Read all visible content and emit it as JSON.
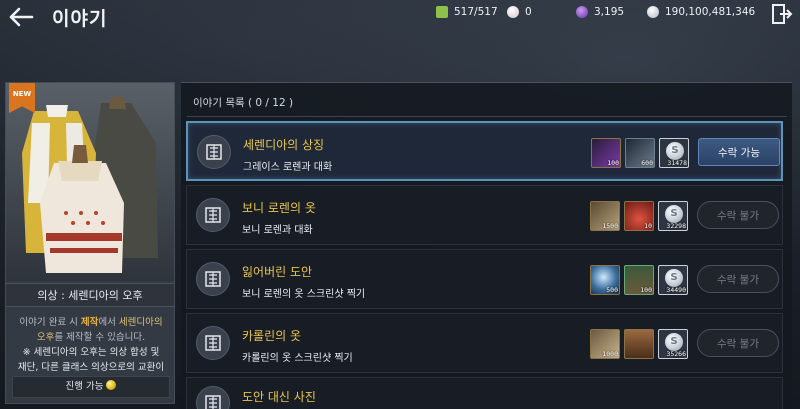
{
  "header": {
    "title": "이야기",
    "resources": [
      {
        "name": "contribution-points",
        "value": "517/517",
        "color": "#8fbf4c"
      },
      {
        "name": "pearls",
        "value": "0",
        "color": "#e9d7db"
      },
      {
        "name": "energy",
        "value": "3,195",
        "color": "#8a53c8"
      },
      {
        "name": "silver",
        "value": "190,100,481,346",
        "color": "#c9d3de"
      }
    ]
  },
  "card": {
    "badge": "NEW",
    "name": "의상 : 세렌디아의 오후",
    "desc": {
      "p1": "이야기 완료 시 ",
      "p2": "제작",
      "p3": "에서 ",
      "p4": "세렌디아의",
      "p5": "오후",
      "p6": "를 제작할 수 있습니다.",
      "p7": "※ 세렌디아의 오후는 의상 합성 및",
      "p8": "재단, 다른 클래스 의상으로의 교환이"
    },
    "progress_label": "진행 가능"
  },
  "list": {
    "title": "이야기 목록 ( 0 / 12 )",
    "quests": [
      {
        "name": "세렌디아의 상징",
        "subtitle": "그레이스 로렌과 대화",
        "button": "수락 가능",
        "state": "accept",
        "rewards": [
          {
            "icon": "purple-gem-icon",
            "count": "100",
            "color": "#7a3aa8"
          },
          {
            "icon": "metal-ingot-icon",
            "count": "600",
            "color": "#52606d"
          },
          {
            "icon": "silver-coin-icon",
            "count": "31478",
            "color": "silver"
          }
        ]
      },
      {
        "name": "보니 로렌의 옷",
        "subtitle": "보니 로렌과 대화",
        "button": "수락 불가",
        "state": "disabled",
        "rewards": [
          {
            "icon": "fabric-icon",
            "count": "1500",
            "color": "#8c7a5a"
          },
          {
            "icon": "red-potion-icon",
            "count": "10",
            "color": "#a5302a"
          },
          {
            "icon": "silver-coin-icon",
            "count": "32298",
            "color": "silver"
          }
        ]
      },
      {
        "name": "잃어버린 도안",
        "subtitle": "보니 로렌의 옷 스크린샷 찍기",
        "button": "수락 불가",
        "state": "disabled",
        "rewards": [
          {
            "icon": "crystal-orb-icon",
            "count": "500",
            "color": "#4a86b8"
          },
          {
            "icon": "chest-icon",
            "count": "100",
            "color": "#6b5a3a"
          },
          {
            "icon": "silver-coin-icon",
            "count": "34490",
            "color": "silver"
          }
        ]
      },
      {
        "name": "카롤린의 옷",
        "subtitle": "카롤린의 옷 스크린샷 찍기",
        "button": "수락 불가",
        "state": "disabled",
        "rewards": [
          {
            "icon": "scroll-icon",
            "count": "1000",
            "color": "#9b8860"
          },
          {
            "icon": "wooden-box-icon",
            "count": "",
            "color": "#7b5535"
          },
          {
            "icon": "silver-coin-icon",
            "count": "35266",
            "color": "silver"
          }
        ]
      },
      {
        "name": "도안 대신 사진",
        "subtitle": "",
        "button": "",
        "state": "disabled",
        "rewards": []
      }
    ]
  }
}
